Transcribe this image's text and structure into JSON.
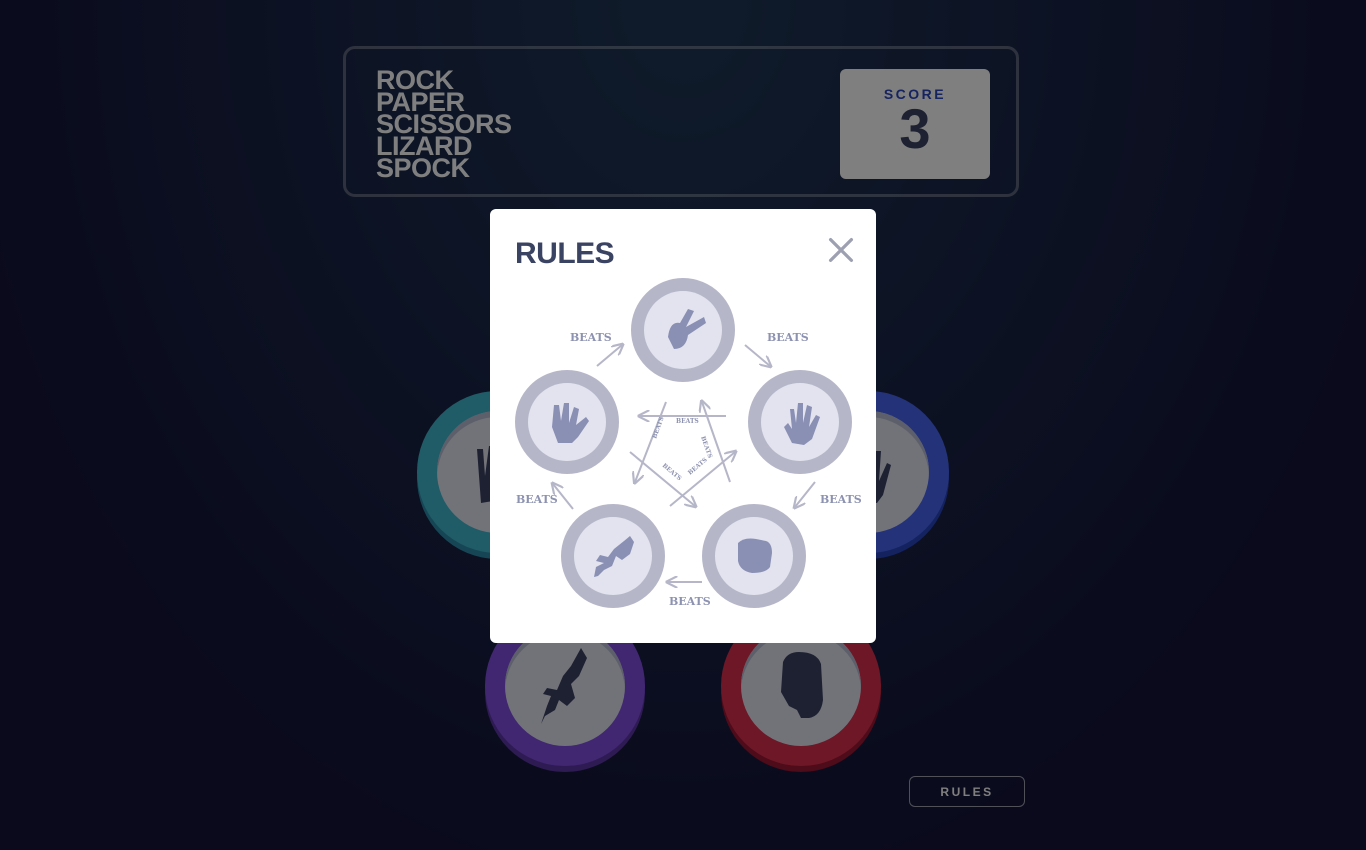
{
  "header": {
    "title_lines": [
      "Rock",
      "Paper",
      "Scissors",
      "Lizard",
      "Spock"
    ],
    "score_label": "Score",
    "score_value": "3"
  },
  "board": {
    "tokens": [
      {
        "name": "scissors",
        "icon": "scissors-icon",
        "color": "#ec9e0e"
      },
      {
        "name": "spock",
        "icon": "spock-icon",
        "color": "#40b9ce"
      },
      {
        "name": "paper",
        "icon": "paper-icon",
        "color": "#4865f4"
      },
      {
        "name": "lizard",
        "icon": "lizard-icon",
        "color": "#834fe3"
      },
      {
        "name": "rock",
        "icon": "rock-icon",
        "color": "#dc2e4e"
      }
    ]
  },
  "footer": {
    "rules_button": "Rules"
  },
  "modal": {
    "title": "Rules",
    "close_icon": "close-icon",
    "beats_label": "BEATS"
  },
  "colors": {
    "dark_text": "#3b4363",
    "score_text": "#2a46c0",
    "header_outline": "#606e85",
    "diagram_gray": "#b5b6c8",
    "icon_fill": "#8a8fb4"
  }
}
